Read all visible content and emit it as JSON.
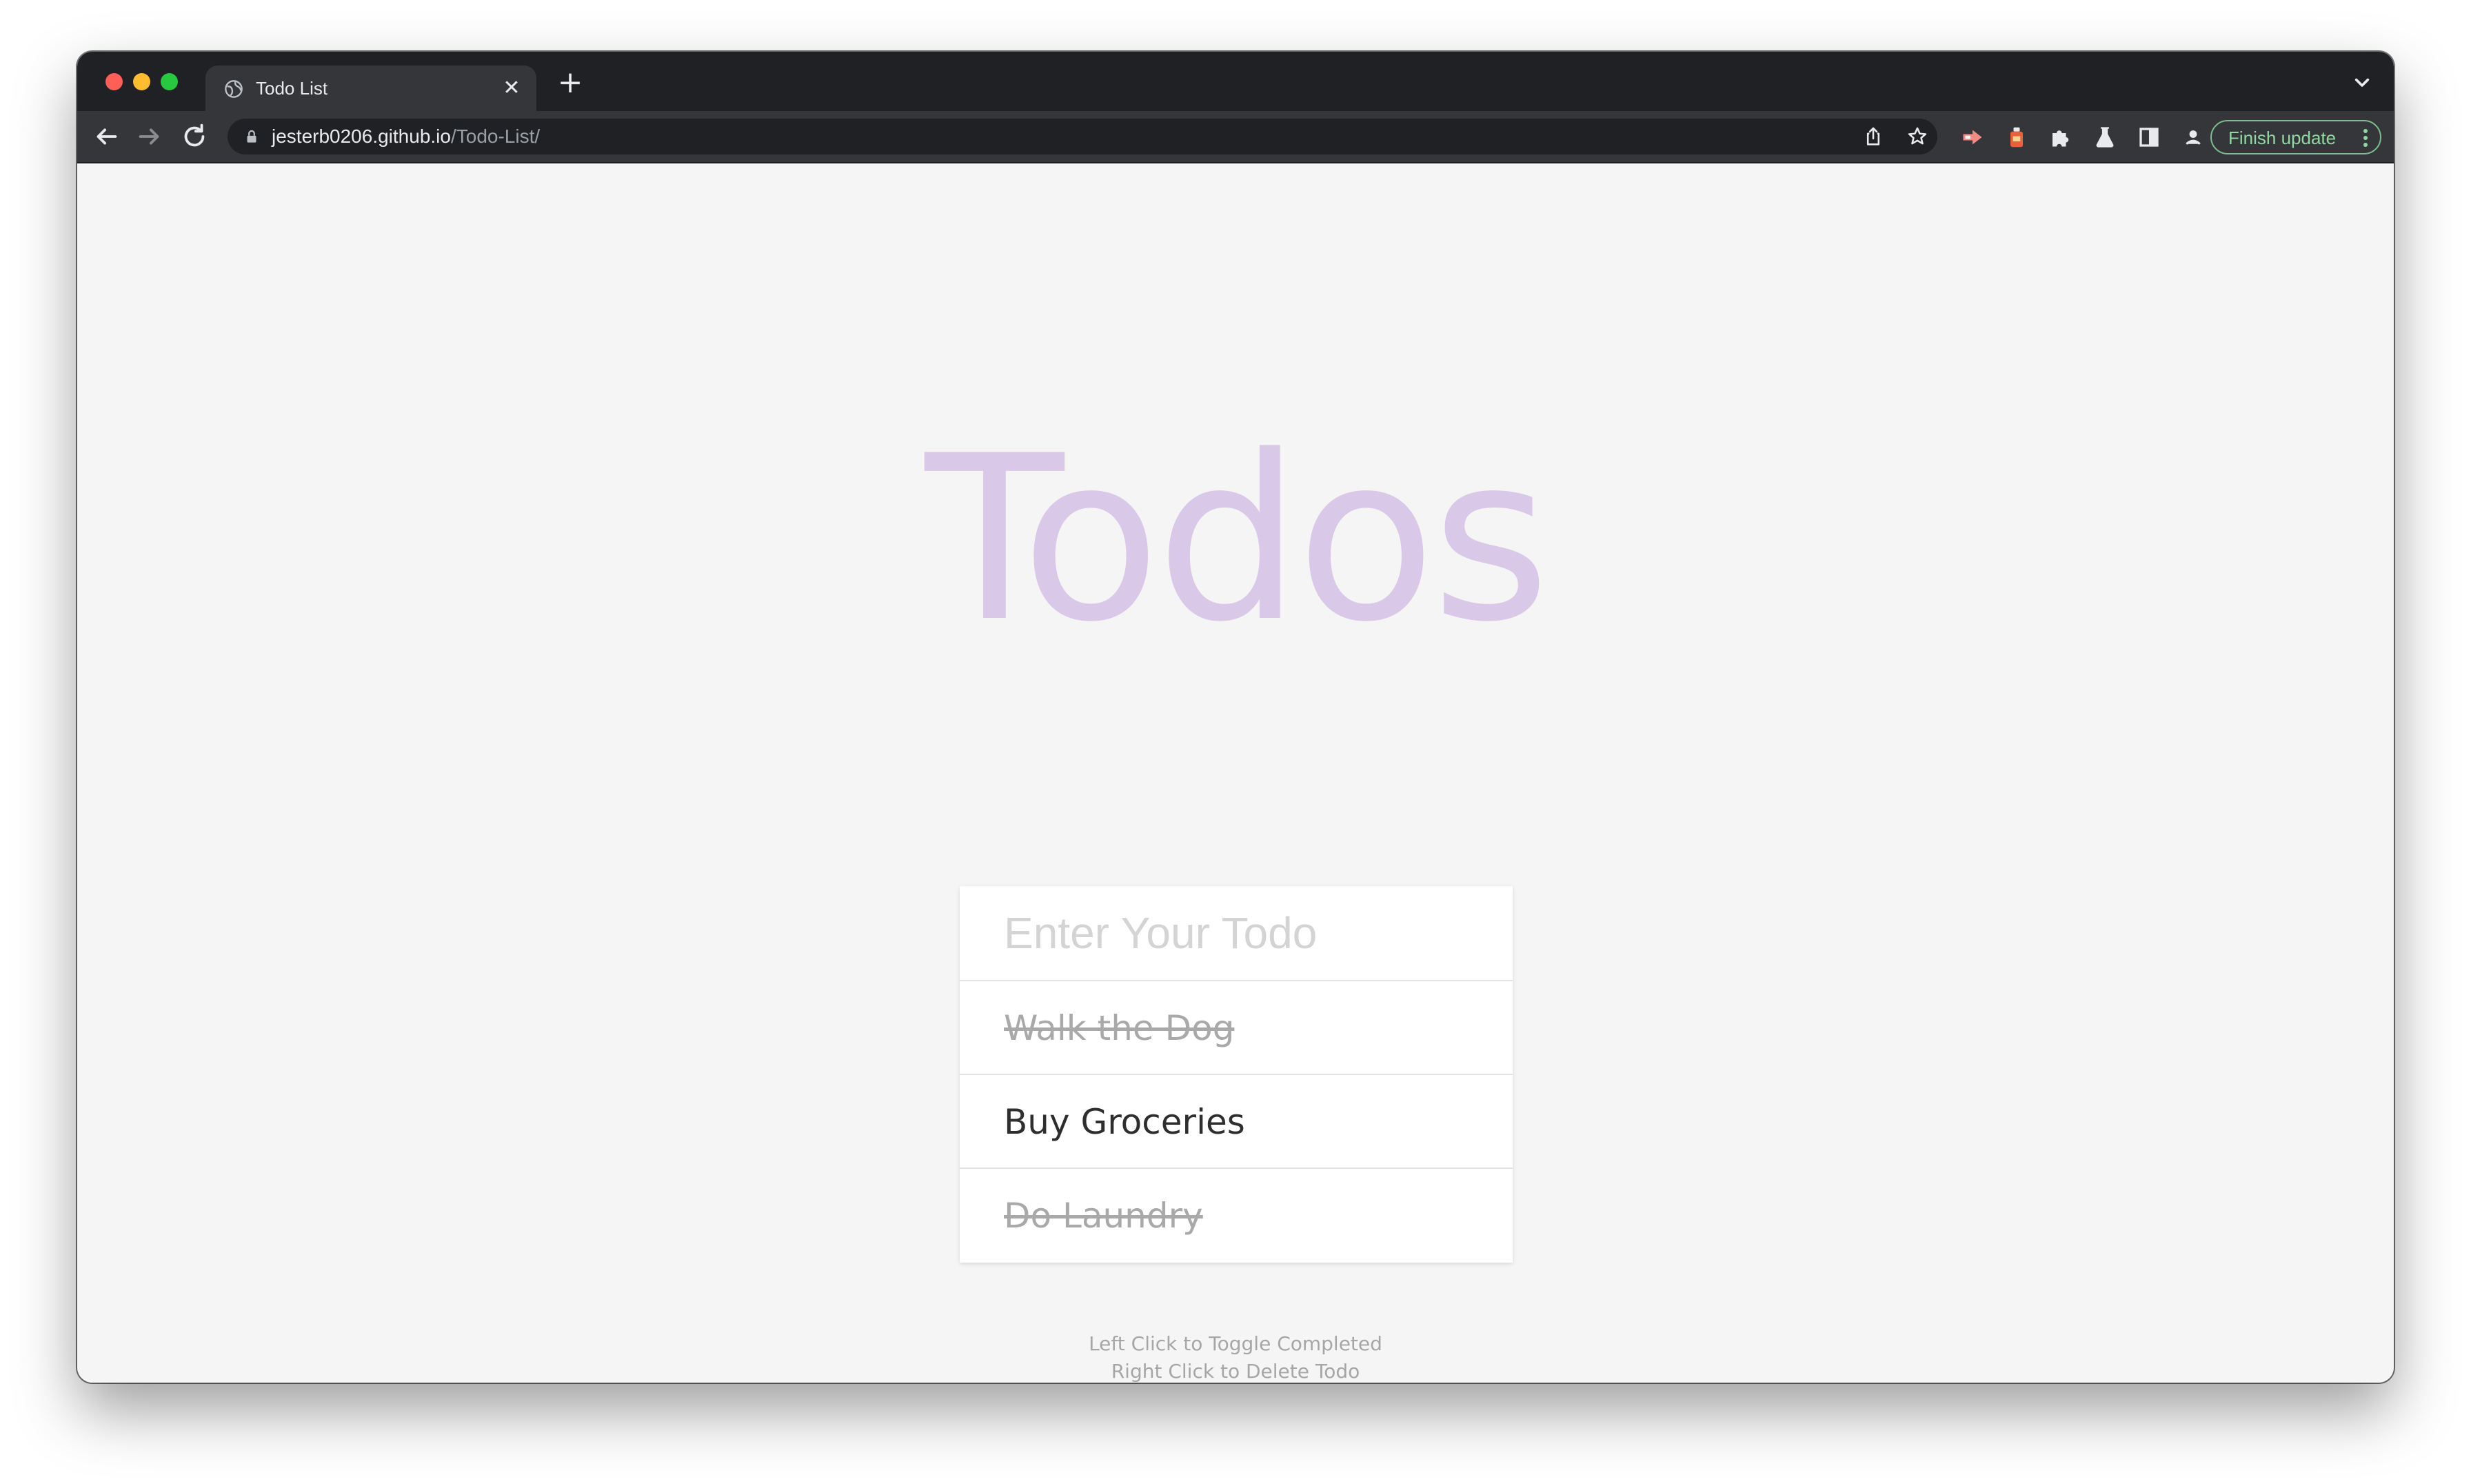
{
  "browser": {
    "tab": {
      "title": "Todo List",
      "favicon": "globe-icon",
      "close_glyph": "✕"
    },
    "new_tab_glyph": "+",
    "address_bar": {
      "host": "jesterb0206.github.io",
      "path": "/Todo-List/"
    },
    "update_button_label": "Finish update",
    "colors": {
      "update_accent": "#8fd8a2",
      "heading": "#dac8e8",
      "completed_text": "#a9a9a9"
    }
  },
  "app": {
    "heading": "Todos",
    "input_placeholder": "Enter Your Todo",
    "input_value": "",
    "todos": [
      {
        "text": "Walk the Dog",
        "completed": true
      },
      {
        "text": "Buy Groceries",
        "completed": false
      },
      {
        "text": "Do Laundry",
        "completed": true
      }
    ],
    "instructions": {
      "line1": "Left Click to Toggle Completed",
      "line2": "Right Click to Delete Todo"
    }
  }
}
